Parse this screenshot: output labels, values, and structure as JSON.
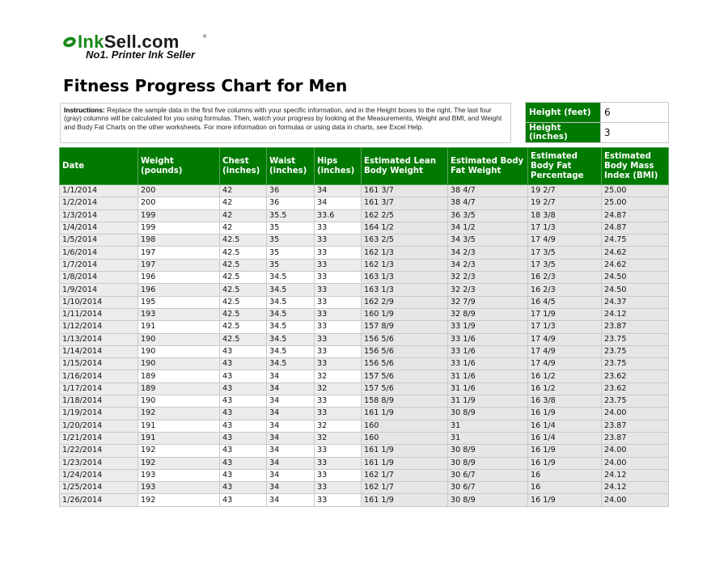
{
  "logo": {
    "brand_part1": "Ink",
    "brand_part2": "Sell.com",
    "registered": "®",
    "tagline": "No1. Printer Ink Seller"
  },
  "title": "Fitness Progress Chart for Men",
  "instructions": {
    "label": "Instructions:",
    "text": " Replace the sample data in the first five columns with your specific information, and in the Height boxes to the right. The last four (gray) columns will be calculated for you using formulas. Then, watch your progress by looking at the Measurements, Weight and BMI, and Weight and Body Fat Charts on the other worksheets. For more information on formulas or using data in charts, see Excel Help."
  },
  "height": {
    "feet_label": "Height (feet)",
    "feet_value": "6",
    "inches_label": "Height (inches)",
    "inches_value": "3"
  },
  "colors": {
    "header_green": "#007a00",
    "gray_cell": "#e6e6e6"
  },
  "table": {
    "headers": [
      "Date",
      "Weight (pounds)",
      "Chest (inches)",
      "Waist (inches)",
      "Hips (inches)",
      "Estimated Lean Body Weight",
      "Estimated Body Fat Weight",
      "Estimated Body Fat Percentage",
      "Estimated Body Mass Index (BMI)"
    ],
    "rows": [
      [
        "1/1/2014",
        "200",
        "42",
        "36",
        "34",
        "161 3/7",
        "38 4/7",
        "19 2/7",
        "25.00"
      ],
      [
        "1/2/2014",
        "200",
        "42",
        "36",
        "34",
        "161 3/7",
        "38 4/7",
        "19 2/7",
        "25.00"
      ],
      [
        "1/3/2014",
        "199",
        "42",
        "35.5",
        "33.6",
        "162 2/5",
        "36 3/5",
        "18 3/8",
        "24.87"
      ],
      [
        "1/4/2014",
        "199",
        "42",
        "35",
        "33",
        "164 1/2",
        "34 1/2",
        "17 1/3",
        "24.87"
      ],
      [
        "1/5/2014",
        "198",
        "42.5",
        "35",
        "33",
        "163 2/5",
        "34 3/5",
        "17 4/9",
        "24.75"
      ],
      [
        "1/6/2014",
        "197",
        "42.5",
        "35",
        "33",
        "162 1/3",
        "34 2/3",
        "17 3/5",
        "24.62"
      ],
      [
        "1/7/2014",
        "197",
        "42.5",
        "35",
        "33",
        "162 1/3",
        "34 2/3",
        "17 3/5",
        "24.62"
      ],
      [
        "1/8/2014",
        "196",
        "42.5",
        "34.5",
        "33",
        "163 1/3",
        "32 2/3",
        "16 2/3",
        "24.50"
      ],
      [
        "1/9/2014",
        "196",
        "42.5",
        "34.5",
        "33",
        "163 1/3",
        "32 2/3",
        "16 2/3",
        "24.50"
      ],
      [
        "1/10/2014",
        "195",
        "42.5",
        "34.5",
        "33",
        "162 2/9",
        "32 7/9",
        "16 4/5",
        "24.37"
      ],
      [
        "1/11/2014",
        "193",
        "42.5",
        "34.5",
        "33",
        "160 1/9",
        "32 8/9",
        "17 1/9",
        "24.12"
      ],
      [
        "1/12/2014",
        "191",
        "42.5",
        "34.5",
        "33",
        "157 8/9",
        "33 1/9",
        "17 1/3",
        "23.87"
      ],
      [
        "1/13/2014",
        "190",
        "42.5",
        "34.5",
        "33",
        "156 5/6",
        "33 1/6",
        "17 4/9",
        "23.75"
      ],
      [
        "1/14/2014",
        "190",
        "43",
        "34.5",
        "33",
        "156 5/6",
        "33 1/6",
        "17 4/9",
        "23.75"
      ],
      [
        "1/15/2014",
        "190",
        "43",
        "34.5",
        "33",
        "156 5/6",
        "33 1/6",
        "17 4/9",
        "23.75"
      ],
      [
        "1/16/2014",
        "189",
        "43",
        "34",
        "32",
        "157 5/6",
        "31 1/6",
        "16 1/2",
        "23.62"
      ],
      [
        "1/17/2014",
        "189",
        "43",
        "34",
        "32",
        "157 5/6",
        "31 1/6",
        "16 1/2",
        "23.62"
      ],
      [
        "1/18/2014",
        "190",
        "43",
        "34",
        "33",
        "158 8/9",
        "31 1/9",
        "16 3/8",
        "23.75"
      ],
      [
        "1/19/2014",
        "192",
        "43",
        "34",
        "33",
        "161 1/9",
        "30 8/9",
        "16 1/9",
        "24.00"
      ],
      [
        "1/20/2014",
        "191",
        "43",
        "34",
        "32",
        "160",
        "31",
        "16 1/4",
        "23.87"
      ],
      [
        "1/21/2014",
        "191",
        "43",
        "34",
        "32",
        "160",
        "31",
        "16 1/4",
        "23.87"
      ],
      [
        "1/22/2014",
        "192",
        "43",
        "34",
        "33",
        "161 1/9",
        "30 8/9",
        "16 1/9",
        "24.00"
      ],
      [
        "1/23/2014",
        "192",
        "43",
        "34",
        "33",
        "161 1/9",
        "30 8/9",
        "16 1/9",
        "24.00"
      ],
      [
        "1/24/2014",
        "193",
        "43",
        "34",
        "33",
        "162 1/7",
        "30 6/7",
        "16",
        "24.12"
      ],
      [
        "1/25/2014",
        "193",
        "43",
        "34",
        "33",
        "162 1/7",
        "30 6/7",
        "16",
        "24.12"
      ],
      [
        "1/26/2014",
        "192",
        "43",
        "34",
        "33",
        "161 1/9",
        "30 8/9",
        "16 1/9",
        "24.00"
      ]
    ]
  }
}
